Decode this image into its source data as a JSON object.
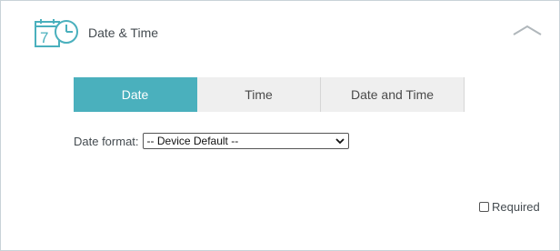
{
  "header": {
    "title": "Date & Time",
    "icon": "calendar-clock-icon",
    "collapse_icon": "chevron-up-icon"
  },
  "tabs": [
    {
      "label": "Date",
      "active": true
    },
    {
      "label": "Time",
      "active": false
    },
    {
      "label": "Date and Time",
      "active": false
    }
  ],
  "date_format": {
    "label": "Date format:",
    "selected": "-- Device Default --"
  },
  "required": {
    "label": "Required",
    "checked": false
  },
  "colors": {
    "accent": "#4ab0bd",
    "tab_inactive": "#efefef",
    "border": "#c9d3d8"
  }
}
